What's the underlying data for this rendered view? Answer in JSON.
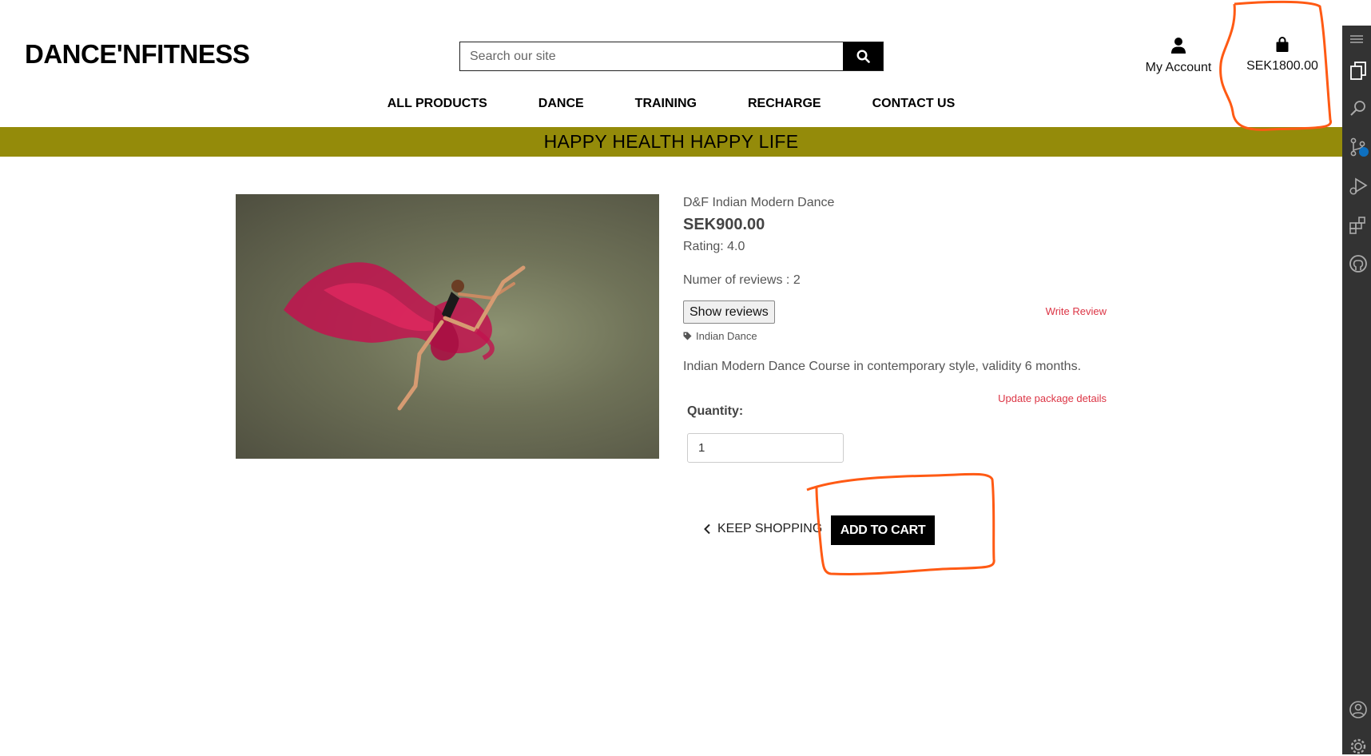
{
  "header": {
    "logo": "DANCE'NFITNESS",
    "search_placeholder": "Search our site",
    "account_label": "My Account",
    "bag_total": "SEK1800.00"
  },
  "nav": {
    "items": [
      "ALL PRODUCTS",
      "DANCE",
      "TRAINING",
      "RECHARGE",
      "CONTACT US"
    ]
  },
  "banner": {
    "text": "HAPPY HEALTH HAPPY LIFE",
    "color": "#948b0a"
  },
  "product": {
    "name": "D&F Indian Modern Dance",
    "price": "SEK900.00",
    "rating": "Rating: 4.0",
    "reviews_count": "Numer of reviews : 2",
    "show_reviews_label": "Show reviews",
    "write_review_label": "Write Review",
    "tag": "Indian Dance",
    "description": "Indian Modern Dance Course in contemporary style, validity 6 months.",
    "update_label": "Update package details",
    "quantity_label": "Quantity:",
    "quantity_value": "1"
  },
  "actions": {
    "keep_shopping": "KEEP SHOPPING",
    "add_to_cart": "ADD TO CART"
  },
  "colors": {
    "accent_link": "#dc3545",
    "annotation": "#ff5a14",
    "sidebar": "#333333"
  }
}
